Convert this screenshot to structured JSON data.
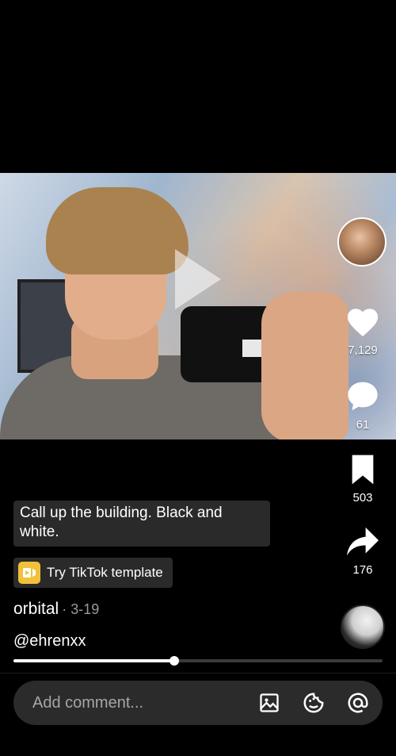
{
  "video": {
    "play_icon": "play-icon",
    "progress_fraction": 0.435
  },
  "rail": {
    "avatar_icon": "creator-avatar",
    "likes": "7,129",
    "comments": "61",
    "saves": "503",
    "shares": "176"
  },
  "caption": {
    "text": "Call up the building. Black and white."
  },
  "template": {
    "label": "Try TikTok template"
  },
  "author": {
    "name": "orbital",
    "date": "· 3-19"
  },
  "mention": {
    "text": "@ehrenxx"
  },
  "comment_bar": {
    "placeholder": "Add comment..."
  },
  "colors": {
    "background": "#000000",
    "caption_bg": "#2a2a2a",
    "template_icon": "#f2c13a",
    "input_bg": "#2b2b2b"
  }
}
